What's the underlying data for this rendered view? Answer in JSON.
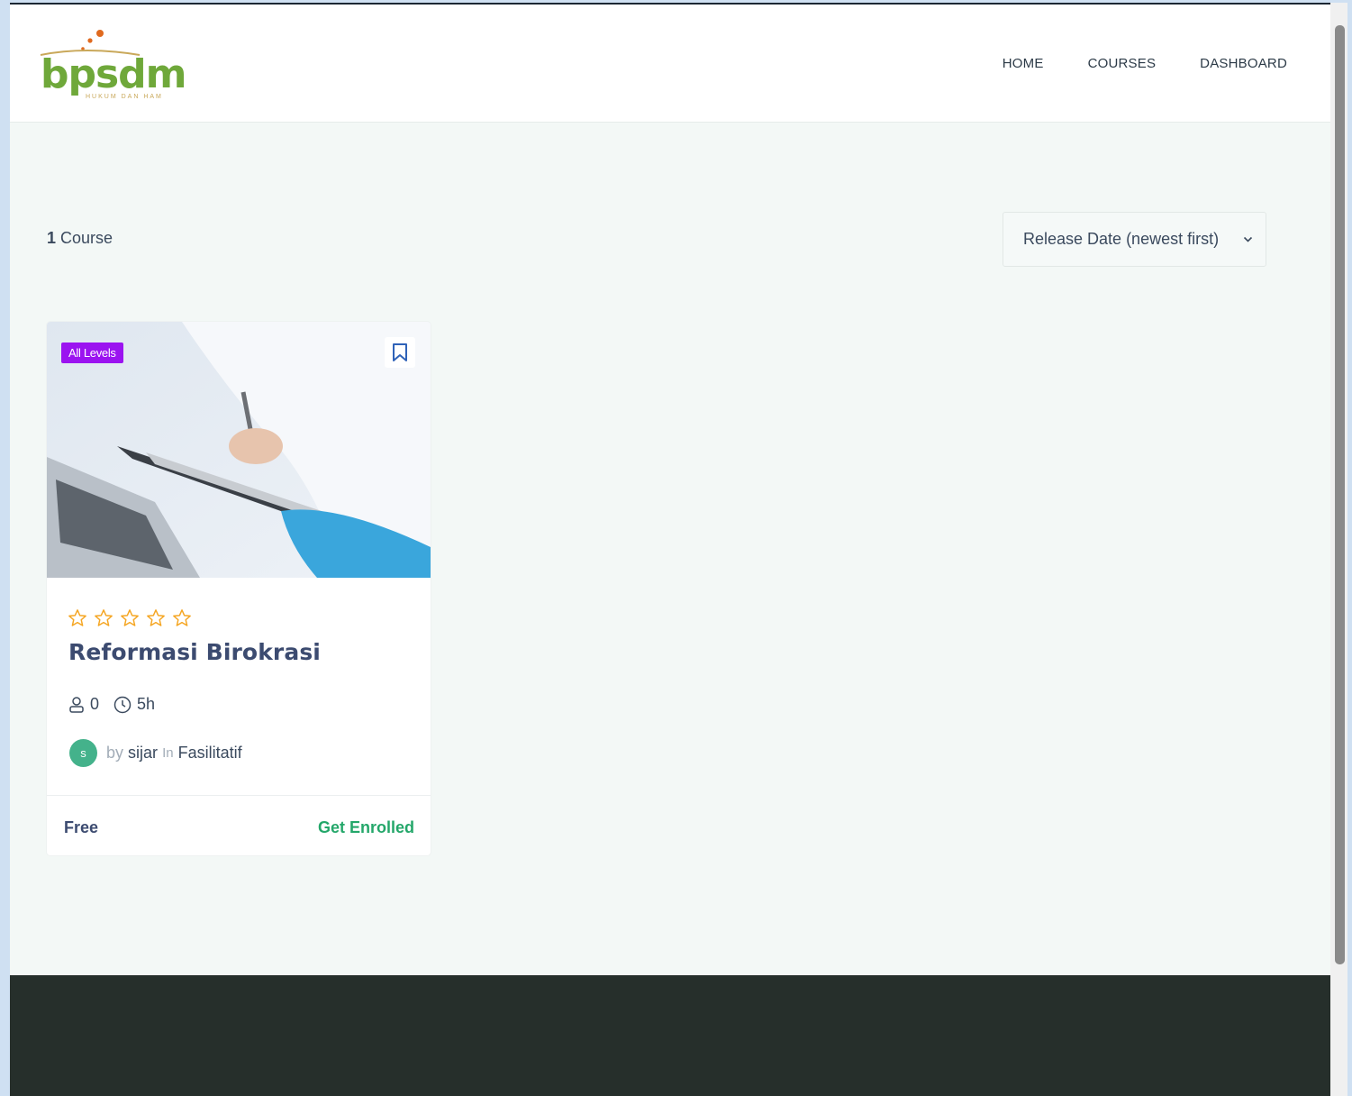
{
  "logo": {
    "text": "bpsdm",
    "subtitle": "HUKUM DAN HAM",
    "colors": {
      "text": "#6fa83a",
      "dots": "#e06a1f"
    }
  },
  "nav": {
    "items": [
      "HOME",
      "COURSES",
      "DASHBOARD"
    ]
  },
  "listing": {
    "count_number": "1",
    "count_label": "Course",
    "sort_selected": "Release Date (newest first)"
  },
  "course": {
    "level_badge": "All Levels",
    "rating_stars": 0,
    "rating_max": 5,
    "title": "Reformasi Birokrasi",
    "students": "0",
    "duration": "5h",
    "avatar_initial": "s",
    "by_label": "by",
    "author": "sijar",
    "in_label": "In",
    "category": "Fasilitatif",
    "price": "Free",
    "cta": "Get Enrolled",
    "icons": [
      "bookmark-icon",
      "star-icon",
      "user-icon",
      "clock-icon"
    ],
    "colors": {
      "badge": "#9b13f0",
      "cta": "#24a76a",
      "star": "#f5a623"
    }
  },
  "colors": {
    "footer": "#262f2b",
    "page": "#f3f8f6"
  }
}
